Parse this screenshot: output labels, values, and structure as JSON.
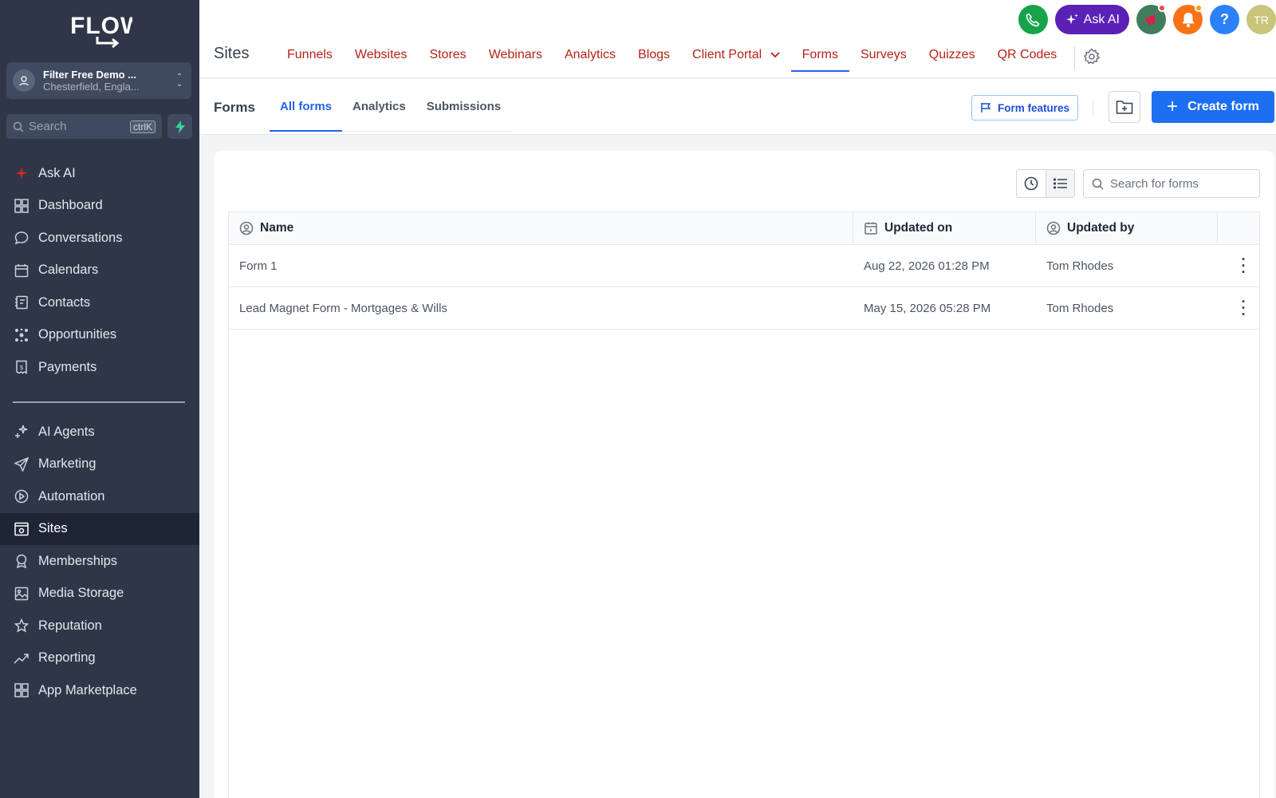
{
  "brand": {
    "logo_text": "FLOW"
  },
  "account": {
    "name": "Filter Free Demo ...",
    "location": "Chesterfield, Engla..."
  },
  "sidebar_search": {
    "placeholder": "Search",
    "shortcut": "ctrlK"
  },
  "sidebar": {
    "items": [
      {
        "label": "Ask AI",
        "icon": "sparkle-icon"
      },
      {
        "label": "Dashboard",
        "icon": "dashboard-icon"
      },
      {
        "label": "Conversations",
        "icon": "chat-icon"
      },
      {
        "label": "Calendars",
        "icon": "calendar-icon"
      },
      {
        "label": "Contacts",
        "icon": "contacts-icon"
      },
      {
        "label": "Opportunities",
        "icon": "opportunities-icon"
      },
      {
        "label": "Payments",
        "icon": "payments-icon"
      }
    ],
    "items2": [
      {
        "label": "AI Agents",
        "icon": "ai-agents-icon"
      },
      {
        "label": "Marketing",
        "icon": "send-icon"
      },
      {
        "label": "Automation",
        "icon": "automation-icon"
      },
      {
        "label": "Sites",
        "icon": "sites-icon",
        "active": true
      },
      {
        "label": "Memberships",
        "icon": "award-icon"
      },
      {
        "label": "Media Storage",
        "icon": "image-icon"
      },
      {
        "label": "Reputation",
        "icon": "star-icon"
      },
      {
        "label": "Reporting",
        "icon": "trend-icon"
      },
      {
        "label": "App Marketplace",
        "icon": "grid-icon"
      }
    ]
  },
  "topbar": {
    "section": "Sites",
    "nav": [
      "Funnels",
      "Websites",
      "Stores",
      "Webinars",
      "Analytics",
      "Blogs",
      "Client Portal",
      "Forms",
      "Surveys",
      "Quizzes",
      "QR Codes"
    ],
    "active_nav": "Forms",
    "ask_ai": "Ask AI",
    "user_initials": "TR"
  },
  "subbar": {
    "title": "Forms",
    "tabs": [
      "All forms",
      "Analytics",
      "Submissions"
    ],
    "active_tab": "All forms",
    "form_features": "Form features",
    "create_form": "Create form"
  },
  "forms_table": {
    "search_placeholder": "Search for forms",
    "columns": [
      "Name",
      "Updated on",
      "Updated by"
    ],
    "rows": [
      {
        "name": "Form 1",
        "updated_on": "Aug 22, 2026 01:28 PM",
        "updated_by": "Tom Rhodes"
      },
      {
        "name": "Lead Magnet Form - Mortgages & Wills",
        "updated_on": "May 15, 2026 05:28 PM",
        "updated_by": "Tom Rhodes"
      }
    ]
  },
  "colors": {
    "sidebar_bg": "#2e3648",
    "accent": "#1d6ff2",
    "nav_text": "#b42318",
    "ask_ai_bg": "#5b21b6",
    "phone_bg": "#16a34a"
  }
}
